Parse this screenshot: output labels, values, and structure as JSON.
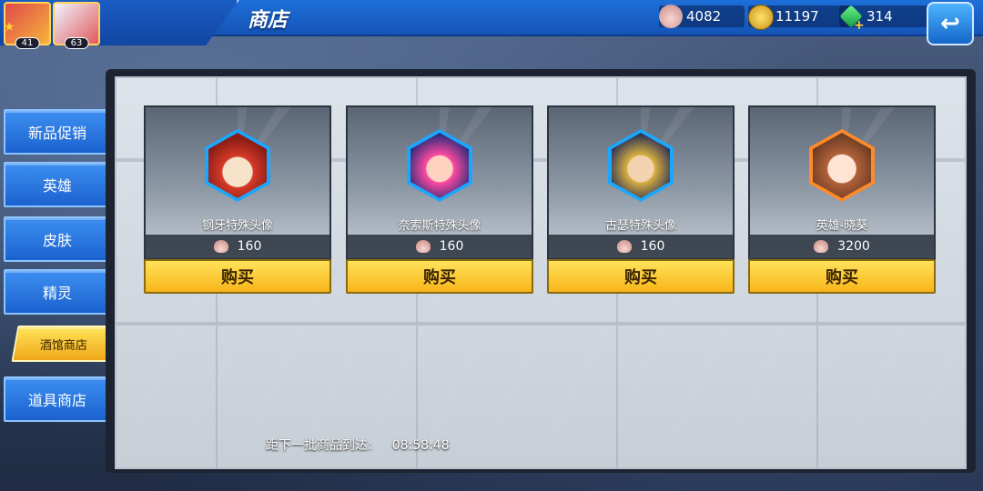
{
  "header": {
    "title": "商店",
    "avatars": [
      {
        "level": "41"
      },
      {
        "level": "63"
      }
    ],
    "resources": {
      "shells": "4082",
      "gold": "11197",
      "gems": "314"
    }
  },
  "nav": {
    "items": [
      {
        "label": "新品促销"
      },
      {
        "label": "英雄"
      },
      {
        "label": "皮肤"
      },
      {
        "label": "精灵"
      },
      {
        "label": "酒馆商店"
      },
      {
        "label": "道具商店"
      }
    ],
    "active_index": 4
  },
  "shop": {
    "items": [
      {
        "name": "钢牙特殊头像",
        "price": "160",
        "buy_label": "购买"
      },
      {
        "name": "奈索斯特殊头像",
        "price": "160",
        "buy_label": "购买"
      },
      {
        "name": "古瑟特殊头像",
        "price": "160",
        "buy_label": "购买"
      },
      {
        "name": "英雄-晓葵",
        "price": "3200",
        "buy_label": "购买"
      }
    ],
    "refresh_label": "距下一批商品到达:",
    "refresh_time": "08:58:48"
  },
  "colors": {
    "accent_blue": "#1e6fd8",
    "buy_yellow": "#f7b519",
    "active_nav": "#ffe45a"
  },
  "icons": [
    "shell-icon",
    "gold-coin-icon",
    "green-gem-icon",
    "back-arrow-icon"
  ]
}
